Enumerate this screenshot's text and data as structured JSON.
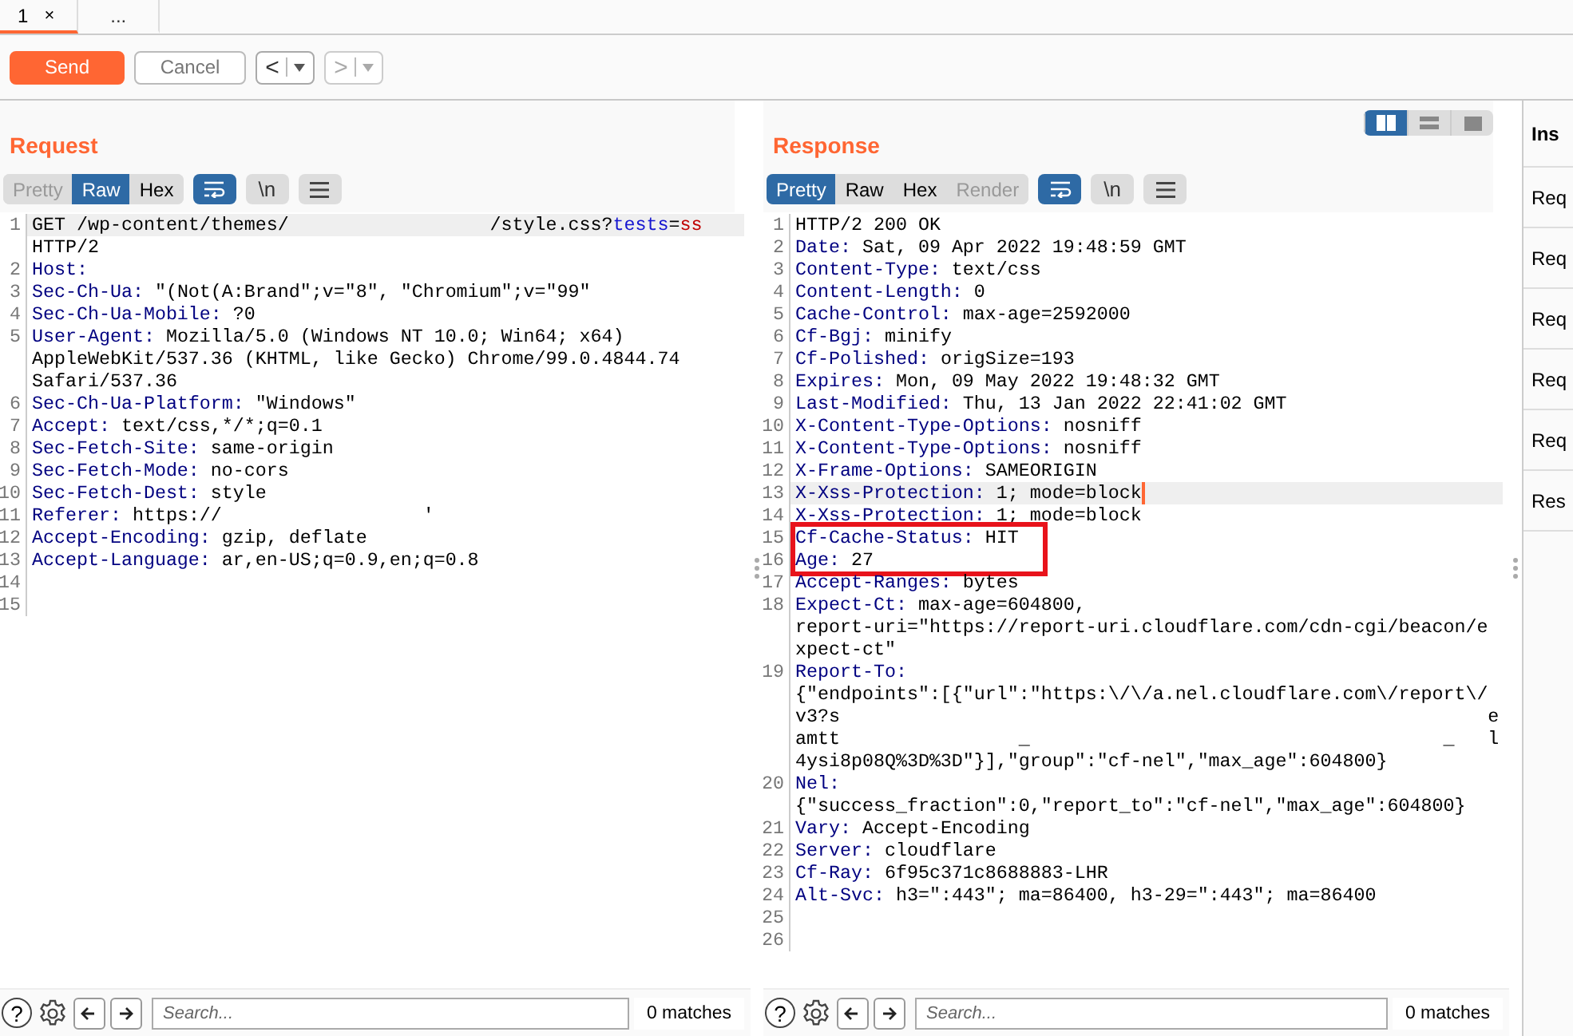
{
  "tabs": [
    {
      "label": "1",
      "close": "×",
      "selected": true
    },
    {
      "label": "...",
      "selected": false
    }
  ],
  "toolbar": {
    "send": {
      "label": "Send",
      "disabled": false
    },
    "cancel": {
      "label": "Cancel",
      "disabled": true
    },
    "back": {
      "label": "<",
      "disabled": false
    },
    "forward": {
      "label": ">",
      "disabled": true
    }
  },
  "layout_toggle": [
    {
      "kind": "columns",
      "selected": true
    },
    {
      "kind": "rows",
      "selected": false
    },
    {
      "kind": "single",
      "selected": false
    }
  ],
  "request": {
    "title": "Request",
    "view_tabs": [
      {
        "label": "Pretty",
        "selected": false,
        "disabled": true
      },
      {
        "label": "Raw",
        "selected": true,
        "disabled": false
      },
      {
        "label": "Hex",
        "selected": false,
        "disabled": false
      }
    ],
    "tools": [
      {
        "kind": "wrap",
        "on": true
      },
      {
        "kind": "newline",
        "text": "\\n",
        "on": false
      },
      {
        "kind": "menu",
        "on": false
      }
    ],
    "lines": [
      {
        "number": "1",
        "current": true,
        "rows": [
          [
            {
              "kind": "plain",
              "text": "GET /wp-content/themes/"
            },
            {
              "kind": "gap"
            },
            {
              "kind": "plain",
              "text": "/style.css?"
            },
            {
              "kind": "param",
              "text": "tests"
            },
            {
              "kind": "plain",
              "text": "="
            },
            {
              "kind": "pvalue",
              "text": "ss"
            }
          ],
          [
            {
              "kind": "plain",
              "text": "HTTP/2"
            }
          ]
        ]
      },
      {
        "number": "2",
        "rows": [
          [
            {
              "kind": "name",
              "text": "Host:"
            }
          ]
        ]
      },
      {
        "number": "3",
        "rows": [
          [
            {
              "kind": "name",
              "text": "Sec-Ch-Ua:"
            },
            {
              "kind": "plain",
              "text": " \"(Not(A:Brand\";v=\"8\", \"Chromium\";v=\"99\""
            }
          ]
        ]
      },
      {
        "number": "4",
        "rows": [
          [
            {
              "kind": "name",
              "text": "Sec-Ch-Ua-Mobile:"
            },
            {
              "kind": "plain",
              "text": " ?0"
            }
          ]
        ]
      },
      {
        "number": "5",
        "rows": [
          [
            {
              "kind": "name",
              "text": "User-Agent:"
            },
            {
              "kind": "plain",
              "text": " Mozilla/5.0 (Windows NT 10.0; Win64; x64)"
            }
          ],
          [
            {
              "kind": "plain",
              "text": "AppleWebKit/537.36 (KHTML, like Gecko) Chrome/99.0.4844.74"
            }
          ],
          [
            {
              "kind": "plain",
              "text": "Safari/537.36"
            }
          ]
        ]
      },
      {
        "number": "6",
        "rows": [
          [
            {
              "kind": "name",
              "text": "Sec-Ch-Ua-Platform:"
            },
            {
              "kind": "plain",
              "text": " \"Windows\""
            }
          ]
        ]
      },
      {
        "number": "7",
        "rows": [
          [
            {
              "kind": "name",
              "text": "Accept:"
            },
            {
              "kind": "plain",
              "text": " text/css,*/*;q=0.1"
            }
          ]
        ]
      },
      {
        "number": "8",
        "rows": [
          [
            {
              "kind": "name",
              "text": "Sec-Fetch-Site:"
            },
            {
              "kind": "plain",
              "text": " same-origin"
            }
          ]
        ]
      },
      {
        "number": "9",
        "rows": [
          [
            {
              "kind": "name",
              "text": "Sec-Fetch-Mode:"
            },
            {
              "kind": "plain",
              "text": " no-cors"
            }
          ]
        ]
      },
      {
        "number": "10",
        "rows": [
          [
            {
              "kind": "name",
              "text": "Sec-Fetch-Dest:"
            },
            {
              "kind": "plain",
              "text": " style"
            }
          ]
        ]
      },
      {
        "number": "11",
        "rows": [
          [
            {
              "kind": "name",
              "text": "Referer:"
            },
            {
              "kind": "plain",
              "text": " https://"
            },
            {
              "kind": "gap"
            },
            {
              "kind": "plain",
              "text": "'"
            }
          ]
        ]
      },
      {
        "number": "12",
        "rows": [
          [
            {
              "kind": "name",
              "text": "Accept-Encoding:"
            },
            {
              "kind": "plain",
              "text": " gzip, deflate"
            }
          ]
        ]
      },
      {
        "number": "13",
        "rows": [
          [
            {
              "kind": "name",
              "text": "Accept-Language:"
            },
            {
              "kind": "plain",
              "text": " ar,en-US;q=0.9,en;q=0.8"
            }
          ]
        ]
      },
      {
        "number": "14",
        "rows": [
          []
        ]
      },
      {
        "number": "15",
        "rows": [
          []
        ]
      }
    ],
    "search": {
      "help": "?",
      "placeholder": "Search...",
      "matches": "0 matches"
    }
  },
  "response": {
    "title": "Response",
    "view_tabs": [
      {
        "label": "Pretty",
        "selected": true,
        "disabled": false
      },
      {
        "label": "Raw",
        "selected": false,
        "disabled": false
      },
      {
        "label": "Hex",
        "selected": false,
        "disabled": false
      },
      {
        "label": "Render",
        "selected": false,
        "disabled": true
      }
    ],
    "tools": [
      {
        "kind": "wrap",
        "on": true
      },
      {
        "kind": "newline",
        "text": "\\n",
        "on": false
      },
      {
        "kind": "menu",
        "on": false
      }
    ],
    "lines": [
      {
        "number": "1",
        "rows": [
          [
            {
              "kind": "plain",
              "text": "HTTP/2 200 OK"
            }
          ]
        ]
      },
      {
        "number": "2",
        "rows": [
          [
            {
              "kind": "name",
              "text": "Date:"
            },
            {
              "kind": "plain",
              "text": " Sat, 09 Apr 2022 19:48:59 GMT"
            }
          ]
        ]
      },
      {
        "number": "3",
        "rows": [
          [
            {
              "kind": "name",
              "text": "Content-Type:"
            },
            {
              "kind": "plain",
              "text": " text/css"
            }
          ]
        ]
      },
      {
        "number": "4",
        "rows": [
          [
            {
              "kind": "name",
              "text": "Content-Length:"
            },
            {
              "kind": "plain",
              "text": " 0"
            }
          ]
        ]
      },
      {
        "number": "5",
        "rows": [
          [
            {
              "kind": "name",
              "text": "Cache-Control:"
            },
            {
              "kind": "plain",
              "text": " max-age=2592000"
            }
          ]
        ]
      },
      {
        "number": "6",
        "rows": [
          [
            {
              "kind": "name",
              "text": "Cf-Bgj:"
            },
            {
              "kind": "plain",
              "text": " minify"
            }
          ]
        ]
      },
      {
        "number": "7",
        "rows": [
          [
            {
              "kind": "name",
              "text": "Cf-Polished:"
            },
            {
              "kind": "plain",
              "text": " origSize=193"
            }
          ]
        ]
      },
      {
        "number": "8",
        "rows": [
          [
            {
              "kind": "name",
              "text": "Expires:"
            },
            {
              "kind": "plain",
              "text": " Mon, 09 May 2022 19:48:32 GMT"
            }
          ]
        ]
      },
      {
        "number": "9",
        "rows": [
          [
            {
              "kind": "name",
              "text": "Last-Modified:"
            },
            {
              "kind": "plain",
              "text": " Thu, 13 Jan 2022 22:41:02 GMT"
            }
          ]
        ]
      },
      {
        "number": "10",
        "rows": [
          [
            {
              "kind": "name",
              "text": "X-Content-Type-Options:"
            },
            {
              "kind": "plain",
              "text": " nosniff"
            }
          ]
        ]
      },
      {
        "number": "11",
        "rows": [
          [
            {
              "kind": "name",
              "text": "X-Content-Type-Options:"
            },
            {
              "kind": "plain",
              "text": " nosniff"
            }
          ]
        ]
      },
      {
        "number": "12",
        "rows": [
          [
            {
              "kind": "name",
              "text": "X-Frame-Options:"
            },
            {
              "kind": "plain",
              "text": " SAMEORIGIN"
            }
          ]
        ]
      },
      {
        "number": "13",
        "current": true,
        "caret": true,
        "rows": [
          [
            {
              "kind": "name",
              "text": "X-Xss-Protection:"
            },
            {
              "kind": "plain",
              "text": " 1; mode=block"
            }
          ]
        ]
      },
      {
        "number": "14",
        "rows": [
          [
            {
              "kind": "name",
              "text": "X-Xss-Protection:"
            },
            {
              "kind": "plain",
              "text": " 1; mode=block"
            }
          ]
        ]
      },
      {
        "number": "15",
        "boxed": true,
        "rows": [
          [
            {
              "kind": "name",
              "text": "Cf-Cache-Status:"
            },
            {
              "kind": "plain",
              "text": " HIT"
            }
          ]
        ]
      },
      {
        "number": "16",
        "boxed": true,
        "rows": [
          [
            {
              "kind": "name",
              "text": "Age:"
            },
            {
              "kind": "plain",
              "text": " 27"
            }
          ]
        ]
      },
      {
        "number": "17",
        "rows": [
          [
            {
              "kind": "name",
              "text": "Accept-Ranges:"
            },
            {
              "kind": "plain",
              "text": " bytes"
            }
          ]
        ]
      },
      {
        "number": "18",
        "rows": [
          [
            {
              "kind": "name",
              "text": "Expect-Ct:"
            },
            {
              "kind": "plain",
              "text": " max-age=604800,"
            }
          ],
          [
            {
              "kind": "plain",
              "text": "report-uri=\"https://report-uri.cloudflare.com/cdn-cgi/beacon/e"
            }
          ],
          [
            {
              "kind": "plain",
              "text": "xpect-ct\""
            }
          ]
        ]
      },
      {
        "number": "19",
        "rows": [
          [
            {
              "kind": "name",
              "text": "Report-To:"
            }
          ],
          [
            {
              "kind": "plain",
              "text": "{\"endpoints\":[{\"url\":\"https:\\/\\/a.nel.cloudflare.com\\/report\\/"
            }
          ],
          [
            {
              "kind": "plain",
              "text": "v3?s                                                          e"
            }
          ],
          [
            {
              "kind": "plain",
              "text": "amtt                _                                     _   l"
            }
          ],
          [
            {
              "kind": "plain",
              "text": "4ysi8p08Q%3D%3D\"}],\"group\":\"cf-nel\",\"max_age\":604800}"
            }
          ]
        ]
      },
      {
        "number": "20",
        "rows": [
          [
            {
              "kind": "name",
              "text": "Nel:"
            }
          ],
          [
            {
              "kind": "plain",
              "text": "{\"success_fraction\":0,\"report_to\":\"cf-nel\",\"max_age\":604800}"
            }
          ]
        ]
      },
      {
        "number": "21",
        "rows": [
          [
            {
              "kind": "name",
              "text": "Vary:"
            },
            {
              "kind": "plain",
              "text": " Accept-Encoding"
            }
          ]
        ]
      },
      {
        "number": "22",
        "rows": [
          [
            {
              "kind": "name",
              "text": "Server:"
            },
            {
              "kind": "plain",
              "text": " cloudflare"
            }
          ]
        ]
      },
      {
        "number": "23",
        "rows": [
          [
            {
              "kind": "name",
              "text": "Cf-Ray:"
            },
            {
              "kind": "plain",
              "text": " 6f95c371c8688883-LHR"
            }
          ]
        ]
      },
      {
        "number": "24",
        "rows": [
          [
            {
              "kind": "name",
              "text": "Alt-Svc:"
            },
            {
              "kind": "plain",
              "text": " h3=\":443\"; ma=86400, h3-29=\":443\"; ma=86400"
            }
          ]
        ]
      },
      {
        "number": "25",
        "rows": [
          []
        ]
      },
      {
        "number": "26",
        "rows": [
          []
        ]
      }
    ],
    "search": {
      "help": "?",
      "placeholder": "Search...",
      "matches": "0 matches"
    }
  },
  "inspector": {
    "title": "Ins",
    "rows": [
      "Req",
      "Req",
      "Req",
      "Req",
      "Req",
      "Res"
    ]
  }
}
